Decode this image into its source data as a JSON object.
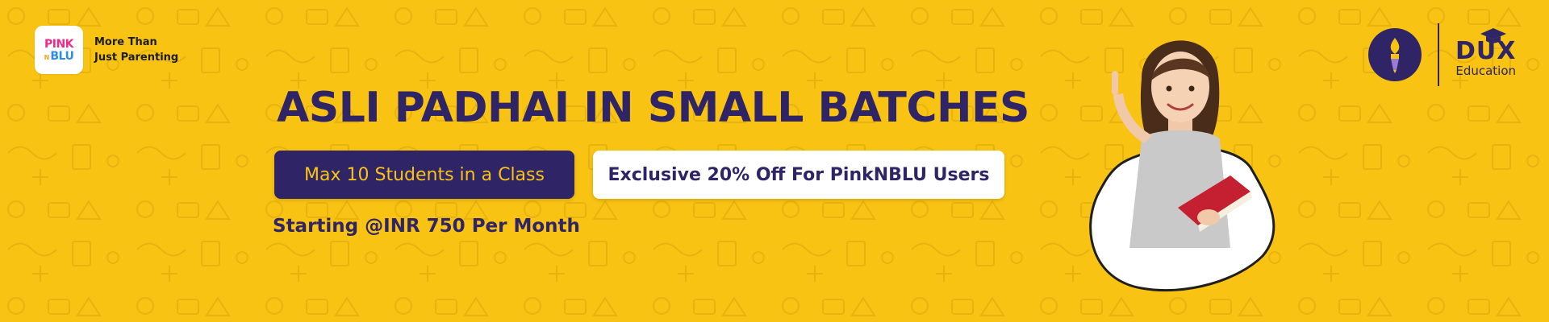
{
  "brand_left": {
    "logo_top": "PINK",
    "logo_n": "N",
    "logo_bottom": "BLU",
    "tagline_line1": "More Than",
    "tagline_line2": "Just Parenting"
  },
  "headline": "ASLI PADHAI IN SMALL BATCHES",
  "features": {
    "batch_size": "Max 10 Students in a Class",
    "offer": "Exclusive 20% Off For PinkNBLU Users"
  },
  "price_line": "Starting @INR 750 Per Month",
  "brand_right": {
    "name": "DUX",
    "subtitle": "Education"
  },
  "colors": {
    "background": "#F9C313",
    "primary": "#2E2466",
    "white": "#FFFFFF",
    "pink": "#EC2C86",
    "blue": "#2E8BE6"
  },
  "icons": {
    "left_logo": "pinknblu-logo",
    "right_emblem": "torch-pen-icon",
    "cap": "graduation-cap-icon"
  }
}
